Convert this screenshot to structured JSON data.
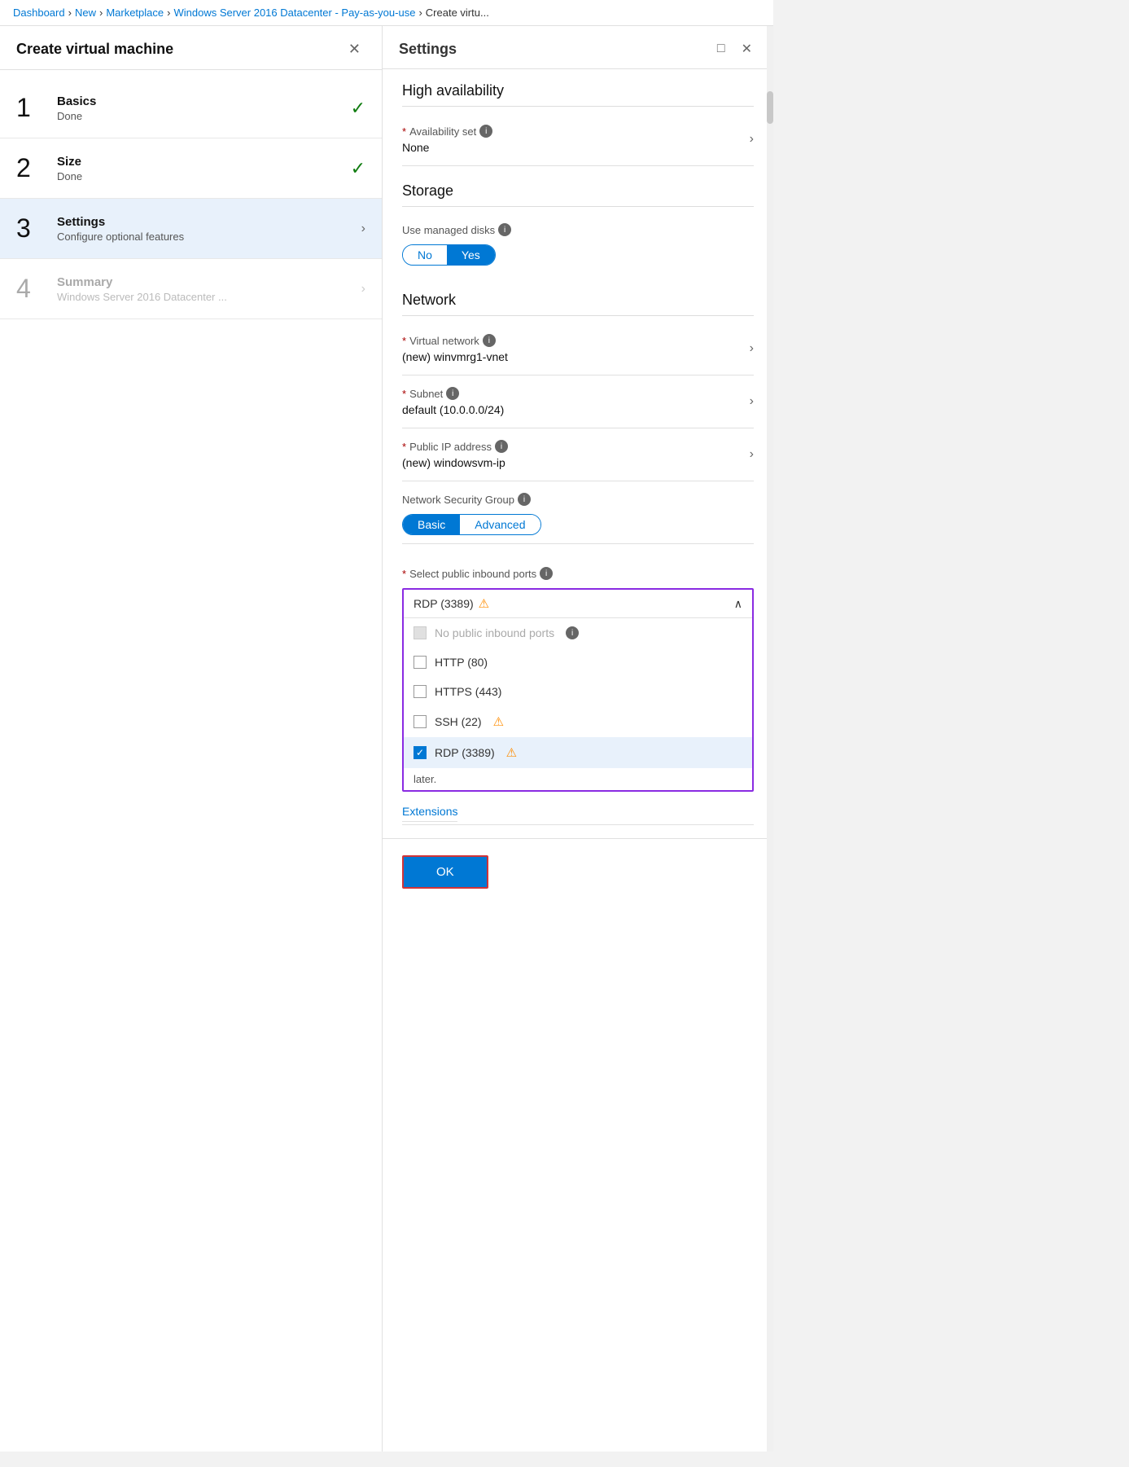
{
  "breadcrumb": {
    "items": [
      "Dashboard",
      "New",
      "Marketplace",
      "Windows Server 2016 Datacenter - Pay-as-you-use",
      "Create virtu..."
    ]
  },
  "left_panel": {
    "title": "Create virtual machine",
    "steps": [
      {
        "number": "1",
        "title": "Basics",
        "subtitle": "Done",
        "state": "done",
        "muted": false
      },
      {
        "number": "2",
        "title": "Size",
        "subtitle": "Done",
        "state": "done",
        "muted": false
      },
      {
        "number": "3",
        "title": "Settings",
        "subtitle": "Configure optional features",
        "state": "active",
        "muted": false
      },
      {
        "number": "4",
        "title": "Summary",
        "subtitle": "Windows Server 2016 Datacenter ...",
        "state": "inactive",
        "muted": true
      }
    ]
  },
  "right_panel": {
    "title": "Settings",
    "sections": {
      "high_availability": {
        "title": "High availability",
        "availability_set": {
          "label": "Availability set",
          "value": "None",
          "required": true
        }
      },
      "storage": {
        "title": "Storage",
        "managed_disks": {
          "label": "Use managed disks",
          "toggle_no": "No",
          "toggle_yes": "Yes",
          "selected": "Yes"
        }
      },
      "network": {
        "title": "Network",
        "virtual_network": {
          "label": "Virtual network",
          "value": "(new) winvmrg1-vnet",
          "required": true
        },
        "subnet": {
          "label": "Subnet",
          "value": "default (10.0.0.0/24)",
          "required": true
        },
        "public_ip": {
          "label": "Public IP address",
          "value": "(new) windowsvm-ip",
          "required": true
        },
        "nsg": {
          "label": "Network Security Group",
          "toggle_basic": "Basic",
          "toggle_advanced": "Advanced",
          "selected": "Basic"
        },
        "inbound_ports": {
          "label": "Select public inbound ports",
          "selected_value": "RDP (3389)",
          "options": [
            {
              "label": "No public inbound ports",
              "checked": false,
              "disabled": true
            },
            {
              "label": "HTTP (80)",
              "checked": false,
              "disabled": false
            },
            {
              "label": "HTTPS (443)",
              "checked": false,
              "disabled": false
            },
            {
              "label": "SSH (22)",
              "checked": false,
              "disabled": false,
              "warning": true
            },
            {
              "label": "RDP (3389)",
              "checked": true,
              "disabled": false,
              "warning": true,
              "selected": true
            }
          ],
          "footer_text": "later."
        }
      }
    },
    "extensions_label": "Extensions",
    "ok_button": "OK"
  }
}
